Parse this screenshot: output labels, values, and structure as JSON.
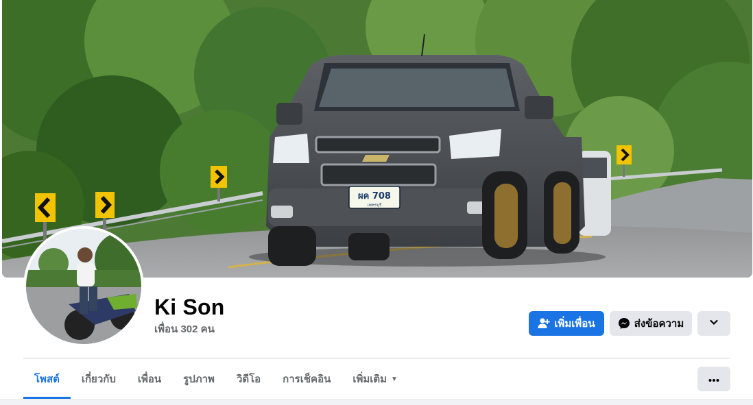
{
  "profile": {
    "name": "Ki Son",
    "friends_count": "เพื่อน 302 คน",
    "cover_plate": "ผค 708",
    "cover_plate_sub": "เพชรบุรี"
  },
  "actions": {
    "add_friend_label": "เพิ่มเพื่อน",
    "message_label": "ส่งข้อความ"
  },
  "tabs": [
    {
      "label": "โพสต์",
      "active": true
    },
    {
      "label": "เกี่ยวกับ",
      "active": false
    },
    {
      "label": "เพื่อน",
      "active": false
    },
    {
      "label": "รูปภาพ",
      "active": false
    },
    {
      "label": "วิดีโอ",
      "active": false
    },
    {
      "label": "การเช็คอิน",
      "active": false
    },
    {
      "label": "เพิ่มเติม",
      "active": false
    }
  ],
  "icons": {
    "add_friend": "person-plus-icon",
    "message": "messenger-icon",
    "dropdown": "chevron-down-icon",
    "more_tab": "caret-down-icon",
    "overflow": "ellipsis-icon"
  },
  "colors": {
    "accent": "#1b74e4",
    "secondary_button": "#e4e6eb",
    "muted_text": "#65676b"
  }
}
